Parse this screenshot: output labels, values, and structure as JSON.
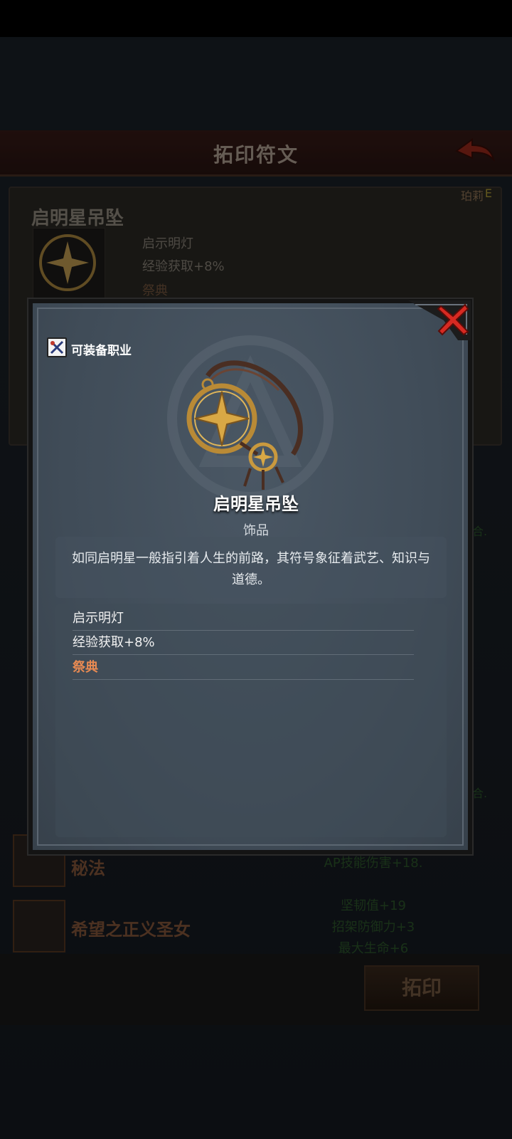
{
  "page": {
    "title": "拓印符文",
    "owner": "珀莉",
    "owner_grade": "E"
  },
  "detail": {
    "name": "启明星吊坠",
    "effects": [
      "启示明灯",
      "经验获取+8%",
      "祭典"
    ]
  },
  "list": [
    {
      "name": "秘法",
      "stat": "AP技能伤害+18."
    },
    {
      "name": "希望之正义圣女",
      "stats": [
        "坚韧值+19",
        "招架防御力+3",
        "最大生命+6"
      ]
    }
  ],
  "side_hint": "合.",
  "bottom": {
    "engrave_label": "拓印"
  },
  "modal": {
    "job_label": "可装备职业",
    "item_name": "启明星吊坠",
    "item_type": "饰品",
    "description": "如同启明星一般指引着人生的前路，其符号象征着武艺、知识与道德。",
    "effects": [
      {
        "text": "启示明灯",
        "keyword": false
      },
      {
        "text": "经验获取+8%",
        "keyword": false
      },
      {
        "text": "祭典",
        "keyword": true
      }
    ],
    "keyword_color": "#e88a52",
    "icons": [
      "close-icon",
      "job-class-icon",
      "pendant-item-art"
    ]
  }
}
